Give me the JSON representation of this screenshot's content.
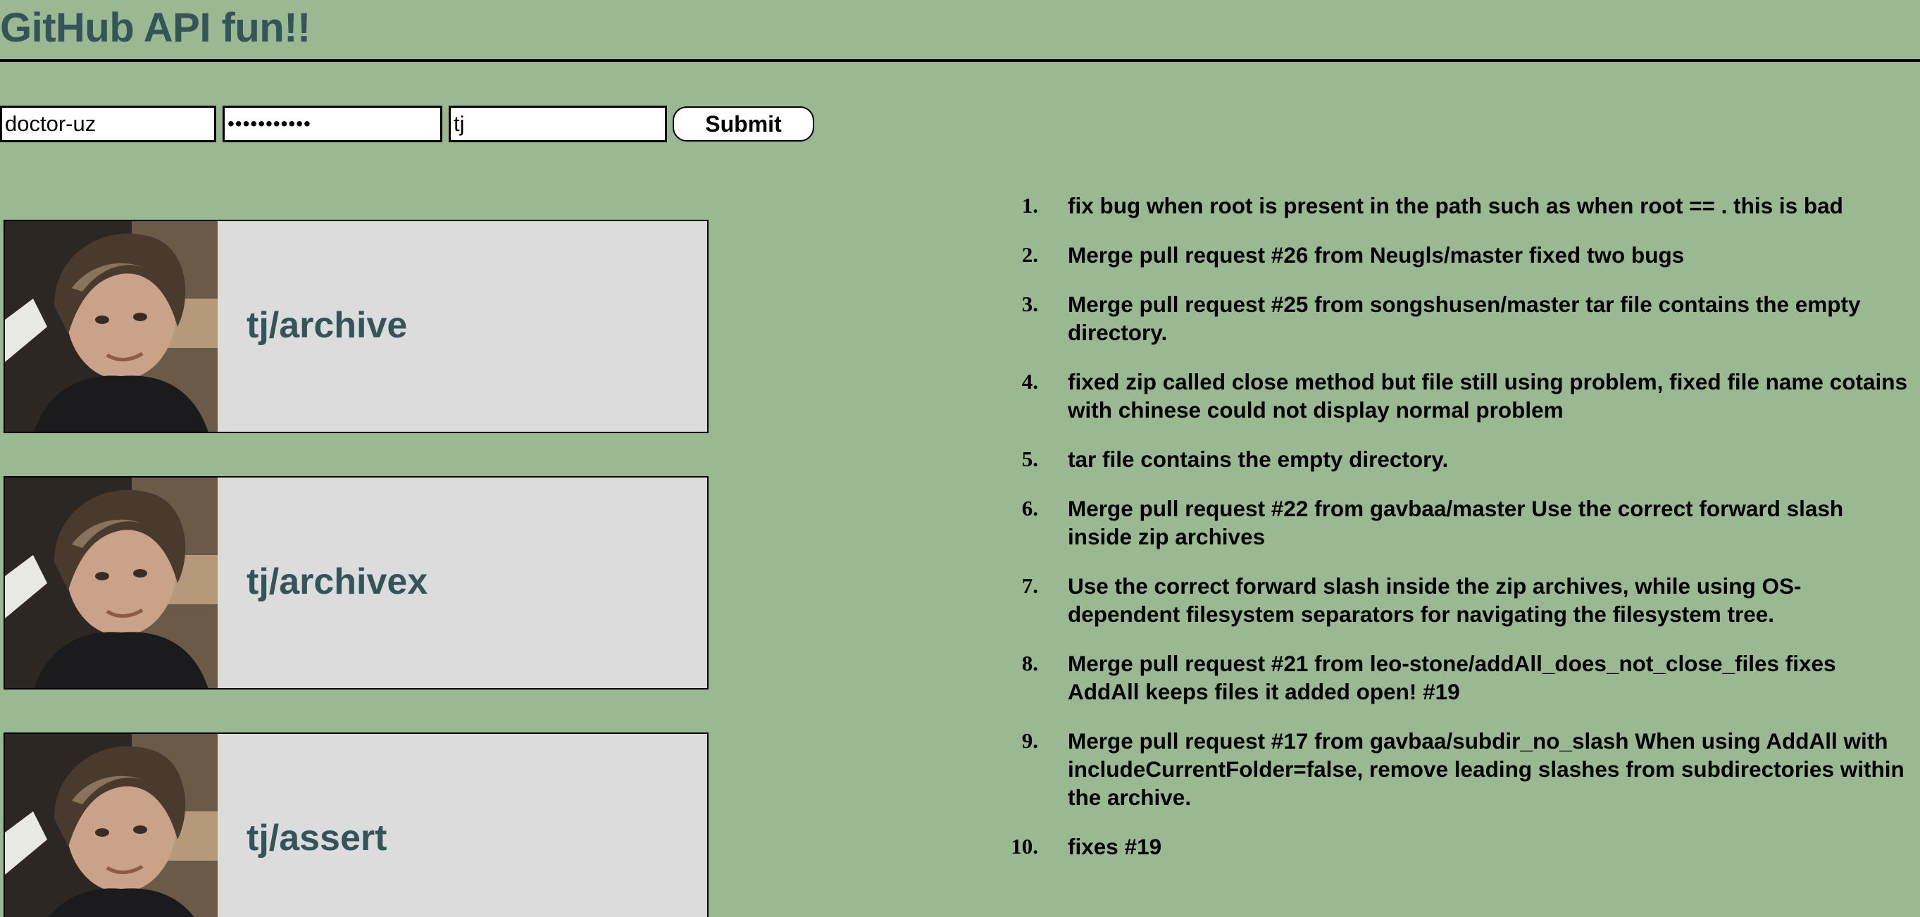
{
  "header": {
    "title": "GitHub API fun!!"
  },
  "form": {
    "username_value": "doctor-uz",
    "password_value": "abcdefghijk",
    "query_value": "tj",
    "submit_label": "Submit"
  },
  "repos": [
    {
      "name": "tj/archive"
    },
    {
      "name": "tj/archivex"
    },
    {
      "name": "tj/assert"
    }
  ],
  "commits": [
    {
      "number": "1.",
      "message": "fix bug when root is present in the path such as when root == . this is bad"
    },
    {
      "number": "2.",
      "message": "Merge pull request #26 from Neugls/master fixed two bugs"
    },
    {
      "number": "3.",
      "message": "Merge pull request #25 from songshusen/master tar file contains the empty directory."
    },
    {
      "number": "4.",
      "message": "fixed zip called close method but file still using problem, fixed file name cotains with chinese could not display normal problem"
    },
    {
      "number": "5.",
      "message": "tar file contains the empty directory."
    },
    {
      "number": "6.",
      "message": "Merge pull request #22 from gavbaa/master Use the correct forward slash inside zip archives"
    },
    {
      "number": "7.",
      "message": "Use the correct forward slash inside the zip archives, while using OS-dependent filesystem separators for navigating the filesystem tree."
    },
    {
      "number": "8.",
      "message": "Merge pull request #21 from leo-stone/addAll_does_not_close_files fixes AddAll keeps files it added open! #19"
    },
    {
      "number": "9.",
      "message": "Merge pull request #17 from gavbaa/subdir_no_slash When using AddAll with includeCurrentFolder=false, remove leading slashes from subdirectories within the archive."
    },
    {
      "number": "10.",
      "message": "fixes #19"
    }
  ]
}
